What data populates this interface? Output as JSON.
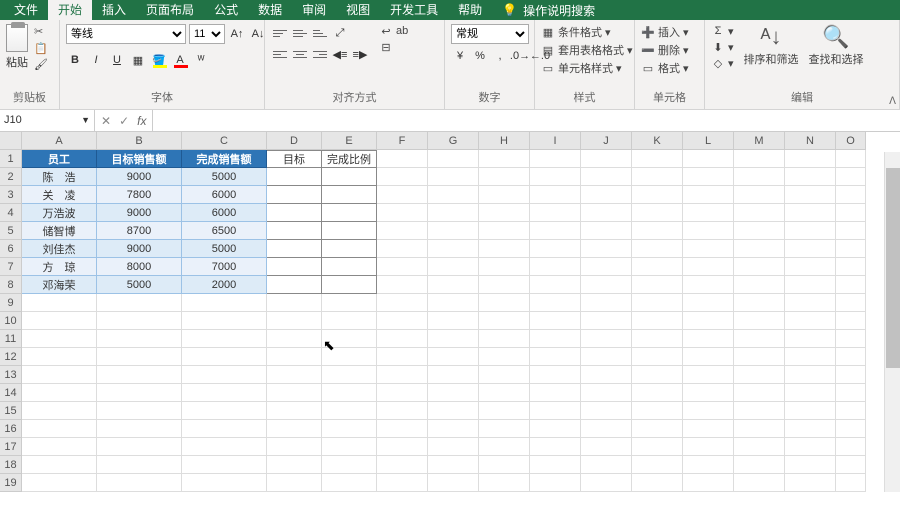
{
  "menu": {
    "tabs": [
      "文件",
      "开始",
      "插入",
      "页面布局",
      "公式",
      "数据",
      "审阅",
      "视图",
      "开发工具",
      "帮助"
    ],
    "active_index": 1,
    "search_placeholder": "操作说明搜索"
  },
  "ribbon": {
    "clipboard": {
      "paste": "粘贴",
      "label": "剪贴板"
    },
    "font": {
      "name": "等线",
      "size": "11",
      "label": "字体"
    },
    "alignment": {
      "label": "对齐方式",
      "wrap": "ab"
    },
    "number": {
      "format": "常规",
      "label": "数字"
    },
    "styles": {
      "cond": "条件格式",
      "tbl": "套用表格格式",
      "cell": "单元格样式",
      "label": "样式"
    },
    "cells": {
      "insert": "插入",
      "delete": "删除",
      "format": "格式",
      "label": "单元格"
    },
    "editing": {
      "sort": "排序和筛选",
      "find": "查找和选择",
      "label": "编辑"
    }
  },
  "formula_bar": {
    "name_box": "J10",
    "fx": "fx",
    "value": ""
  },
  "columns": [
    "A",
    "B",
    "C",
    "D",
    "E",
    "F",
    "G",
    "H",
    "I",
    "J",
    "K",
    "L",
    "M",
    "N",
    "O"
  ],
  "rows": [
    1,
    2,
    3,
    4,
    5,
    6,
    7,
    8,
    9,
    10,
    11,
    12,
    13,
    14,
    15,
    16,
    17,
    18,
    19
  ],
  "table": {
    "headers": {
      "a": "员工",
      "b": "目标销售额",
      "c": "完成销售额",
      "d": "目标",
      "e": "完成比例"
    },
    "data": [
      {
        "a": "陈　浩",
        "b": "9000",
        "c": "5000"
      },
      {
        "a": "关　凌",
        "b": "7800",
        "c": "6000"
      },
      {
        "a": "万浩波",
        "b": "9000",
        "c": "6000"
      },
      {
        "a": "储智博",
        "b": "8700",
        "c": "6500"
      },
      {
        "a": "刘佳杰",
        "b": "9000",
        "c": "5000"
      },
      {
        "a": "方　琼",
        "b": "8000",
        "c": "7000"
      },
      {
        "a": "邓海荣",
        "b": "5000",
        "c": "2000"
      }
    ]
  }
}
